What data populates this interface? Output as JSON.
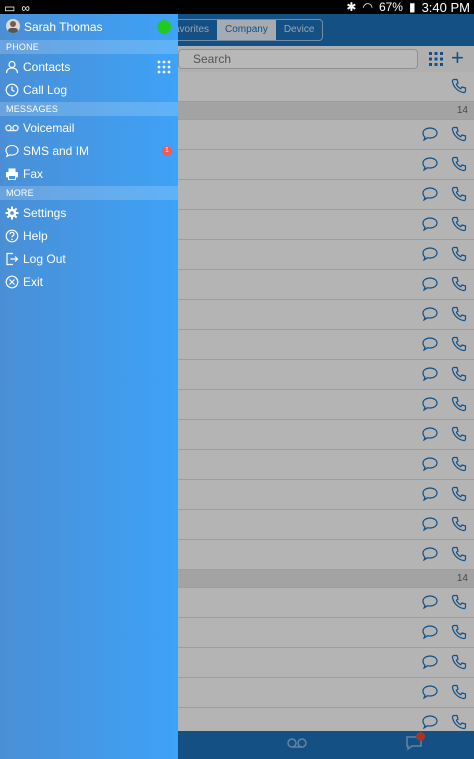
{
  "status_bar": {
    "battery": "67%",
    "time": "3:40 PM"
  },
  "background_app": {
    "tabs": [
      "avorites",
      "Company",
      "Device"
    ],
    "search_placeholder": "Search",
    "section_counts": [
      "14",
      "14"
    ]
  },
  "drawer": {
    "user_name": "Sarah Thomas",
    "sections": {
      "phone": "PHONE",
      "messages": "MESSAGES",
      "more": "MORE"
    },
    "items": {
      "contacts": "Contacts",
      "call_log": "Call Log",
      "voicemail": "Voicemail",
      "sms": "SMS and IM",
      "sms_badge": "1",
      "fax": "Fax",
      "settings": "Settings",
      "help": "Help",
      "logout": "Log Out",
      "exit": "Exit"
    }
  },
  "colors": {
    "presence": "#21c927",
    "brand": "#1d6fb8",
    "badge": "#f05a5a"
  }
}
